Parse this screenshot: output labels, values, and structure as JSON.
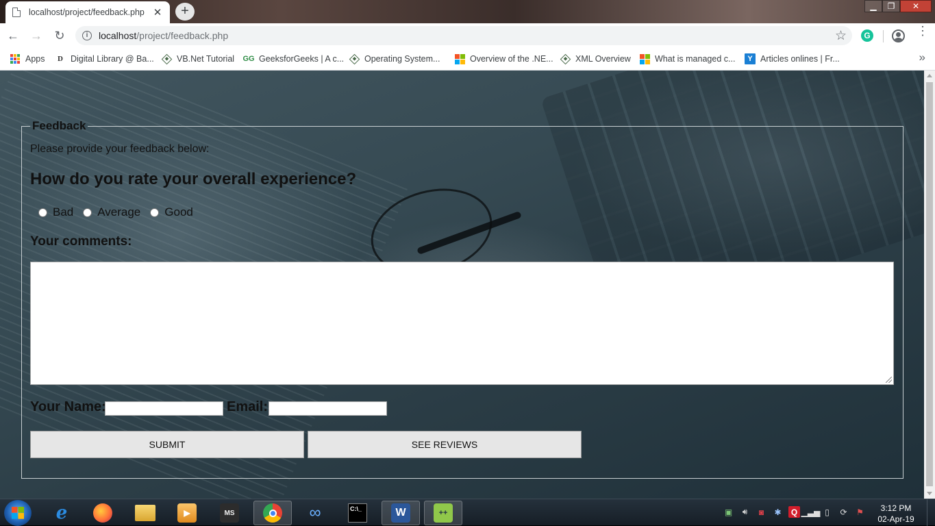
{
  "browser": {
    "tab_title": "localhost/project/feedback.php",
    "tab_close": "✕",
    "new_tab": "+",
    "window_controls": {
      "minimize": "▁",
      "maximize": "❐",
      "close": "✕"
    },
    "nav": {
      "back": "←",
      "forward": "→",
      "reload": "↻"
    },
    "url_host": "localhost",
    "url_path": "/project/feedback.php",
    "extension_badge": "G",
    "more_bookmarks": "»"
  },
  "bookmarks": [
    {
      "label": "Apps",
      "icon": "apps-grid-icon"
    },
    {
      "label": "Digital Library @ Ba...",
      "icon": "d-logo-icon"
    },
    {
      "label": "VB.Net Tutorial",
      "icon": "diamond-site-icon"
    },
    {
      "label": "GeeksforGeeks | A c...",
      "icon": "gfg-icon"
    },
    {
      "label": "Operating System...",
      "icon": "diamond-site-icon"
    },
    {
      "label": "Overview of the .NE...",
      "icon": "microsoft-icon"
    },
    {
      "label": "XML Overview",
      "icon": "diamond-site-icon"
    },
    {
      "label": "What is managed c...",
      "icon": "microsoft-icon"
    },
    {
      "label": "Articles onlines | Fr...",
      "icon": "y-logo-icon"
    }
  ],
  "form": {
    "legend": "Feedback",
    "intro": "Please provide your feedback below:",
    "question": "How do you rate your overall experience?",
    "ratings": [
      "Bad",
      "Average",
      "Good"
    ],
    "comments_label": "Your comments:",
    "comments_value": "",
    "name_label": "Your Name:",
    "name_value": "",
    "email_label": "Email:",
    "email_value": "",
    "submit_label": "SUBMIT",
    "reviews_label": "SEE REVIEWS"
  },
  "taskbar": {
    "apps": [
      "internet-explorer",
      "firefox",
      "file-explorer",
      "media-player",
      "ms-project",
      "chrome",
      "infinity-app",
      "command-prompt",
      "ms-word",
      "notepad-plus-plus"
    ],
    "active_app": "chrome",
    "time": "3:12 PM",
    "date": "02-Apr-19"
  }
}
